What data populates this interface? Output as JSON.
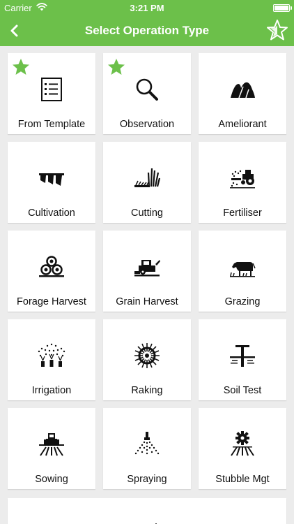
{
  "status": {
    "carrier": "Carrier",
    "time": "3:21 PM"
  },
  "nav": {
    "title": "Select Operation Type",
    "back_icon": "chevron-left-icon",
    "favorites_icon": "star-outline-icon"
  },
  "colors": {
    "brand": "#6cc04a",
    "favorite_star": "#6cc04a",
    "background": "#ececec",
    "tile": "#ffffff",
    "text": "#111111"
  },
  "tiles": [
    {
      "label": "From Template",
      "icon": "checklist-icon",
      "favorite": true
    },
    {
      "label": "Observation",
      "icon": "magnifier-icon",
      "favorite": true
    },
    {
      "label": "Ameliorant",
      "icon": "lime-pile-icon",
      "favorite": false
    },
    {
      "label": "Cultivation",
      "icon": "plough-icon",
      "favorite": false
    },
    {
      "label": "Cutting",
      "icon": "mower-grass-icon",
      "favorite": false
    },
    {
      "label": "Fertiliser",
      "icon": "tractor-spreader-icon",
      "favorite": false
    },
    {
      "label": "Forage Harvest",
      "icon": "hay-bales-icon",
      "favorite": false
    },
    {
      "label": "Grain Harvest",
      "icon": "combine-harvester-icon",
      "favorite": false
    },
    {
      "label": "Grazing",
      "icon": "cow-icon",
      "favorite": false
    },
    {
      "label": "Irrigation",
      "icon": "sprinklers-icon",
      "favorite": false
    },
    {
      "label": "Raking",
      "icon": "rake-wheel-icon",
      "favorite": false
    },
    {
      "label": "Soil Test",
      "icon": "soil-probe-icon",
      "favorite": false
    },
    {
      "label": "Sowing",
      "icon": "seeder-tractor-icon",
      "favorite": false
    },
    {
      "label": "Spraying",
      "icon": "spray-nozzle-icon",
      "favorite": false
    },
    {
      "label": "Stubble Mgt",
      "icon": "stubble-gear-icon",
      "favorite": false
    }
  ]
}
